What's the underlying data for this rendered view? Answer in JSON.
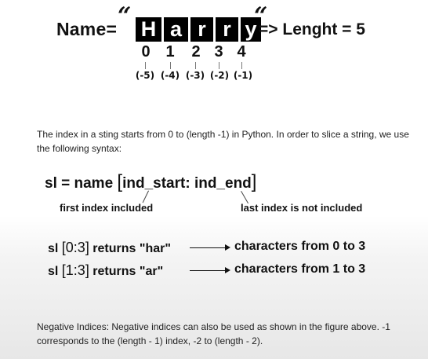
{
  "diagram": {
    "name_label": "Name=",
    "quote_open": "“",
    "quote_close": "“",
    "letters": [
      "H",
      "a",
      "r",
      "r",
      "y"
    ],
    "arrow_text": "=> Lenght = 5",
    "indices": [
      "0",
      "1",
      "2",
      "3",
      "4"
    ],
    "negative_indices": [
      "(-5)",
      "(-4)",
      "(-3)",
      "(-2)",
      "(-1)"
    ]
  },
  "paragraph": "The index in a sting starts from 0 to (length -1) in Python. In order to slice a string, we use the following syntax:",
  "syntax": {
    "prefix": "sl = name",
    "bracket_open": "[",
    "inner": "ind_start: ind_end",
    "bracket_close": "]",
    "note_start": "first index included",
    "note_end": "last index is not included"
  },
  "examples": [
    {
      "code_prefix": "sl",
      "code_bracket": "[0:3]",
      "code_suffix": "returns \"har\"",
      "description": "characters from 0 to 3"
    },
    {
      "code_prefix": "sl",
      "code_bracket": "[1:3]",
      "code_suffix": "returns \"ar\"",
      "description": "characters from 1 to 3"
    }
  ],
  "negative_note": "Negative Indices: Negative indices can also be used as shown in the figure above. -1 corresponds to the (length - 1) index, -2 to (length - 2)."
}
